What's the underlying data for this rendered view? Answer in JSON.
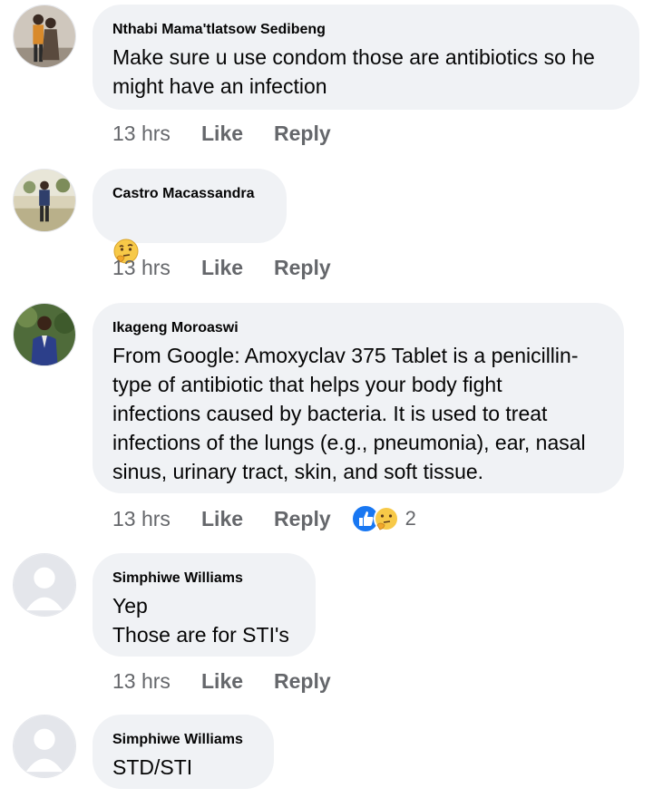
{
  "comments": [
    {
      "author": "Nthabi Mama'tlatsow Sedibeng",
      "text": "Make sure u use condom those are antibiotics so he\nmight have an infection",
      "time": "13 hrs",
      "like_label": "Like",
      "reply_label": "Reply",
      "avatar_icon": "couple-photo-icon"
    },
    {
      "author": "Castro Macassandra",
      "text": "",
      "emoji": "thinking-face-icon",
      "time": "13 hrs",
      "like_label": "Like",
      "reply_label": "Reply",
      "avatar_icon": "person-outdoors-photo-icon"
    },
    {
      "author": "Ikageng Moroaswi",
      "text": "From Google: Amoxyclav 375 Tablet is a penicillin-\ntype of antibiotic that helps your body fight\ninfections caused by bacteria. It is used to treat\ninfections of the lungs (e.g., pneumonia), ear, nasal\nsinus, urinary tract, skin, and soft tissue.",
      "time": "13 hrs",
      "like_label": "Like",
      "reply_label": "Reply",
      "reaction_count": "2",
      "reaction_icons": [
        "like-reaction-icon",
        "thinking-reaction-icon"
      ],
      "avatar_icon": "person-suit-photo-icon"
    },
    {
      "author": "Simphiwe Williams",
      "text": "Yep\nThose are for STI's",
      "time": "13 hrs",
      "like_label": "Like",
      "reply_label": "Reply",
      "avatar_icon": "default-avatar-icon"
    },
    {
      "author": "Simphiwe Williams",
      "text": "STD/STI",
      "avatar_icon": "default-avatar-icon"
    }
  ],
  "colors": {
    "bubble": "#f0f2f5",
    "meta_text": "#65676b",
    "like_blue": "#1877f2",
    "thinking_yellow": "#f7b928"
  }
}
